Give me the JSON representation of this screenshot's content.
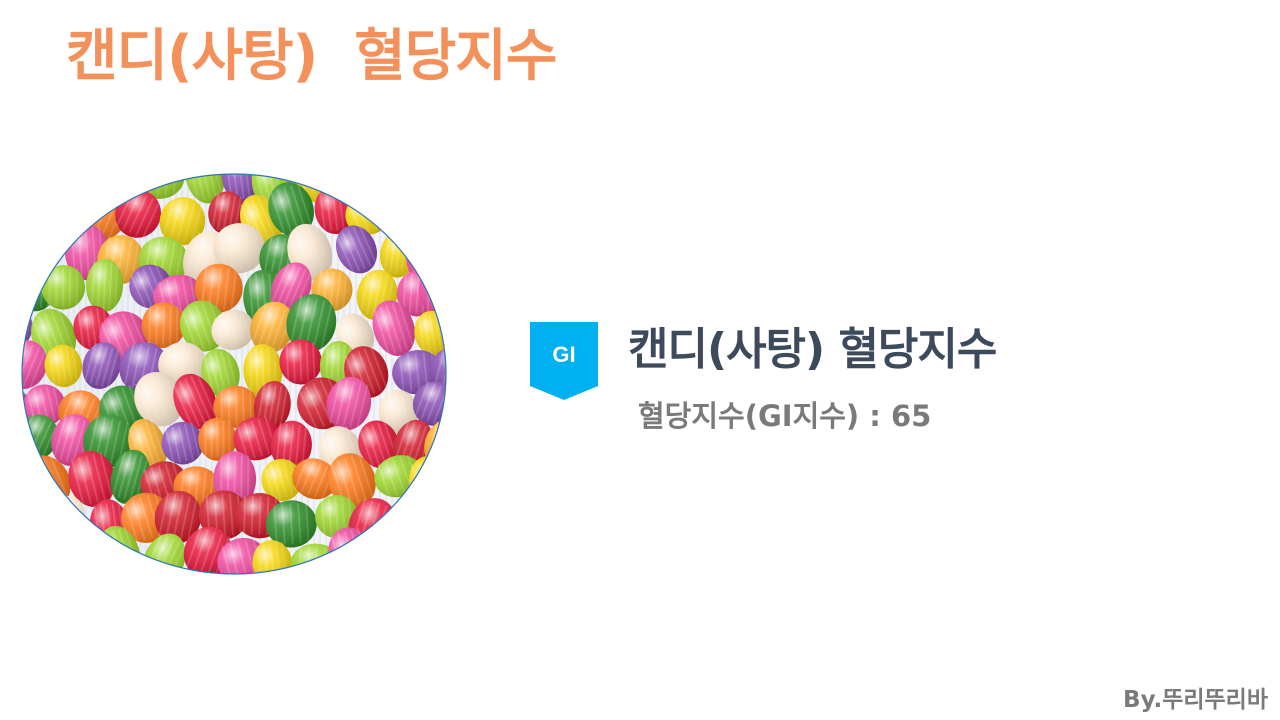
{
  "slide": {
    "title": "캔디(사탕)  혈당지수",
    "badge": {
      "label": "GI",
      "color": "#00b0f0"
    },
    "food_heading": "캔디(사탕) 혈당지수",
    "gi_line": "혈당지수(GI지수) : 65",
    "gi_value": 65,
    "credit": "By.뚜리뚜리바",
    "colors": {
      "title": "#f4915a",
      "heading": "#3d4a5c",
      "body_text": "#7a7a7a",
      "photo_border": "#2e75b6"
    },
    "photo": {
      "subject": "colorful hard candies"
    }
  }
}
